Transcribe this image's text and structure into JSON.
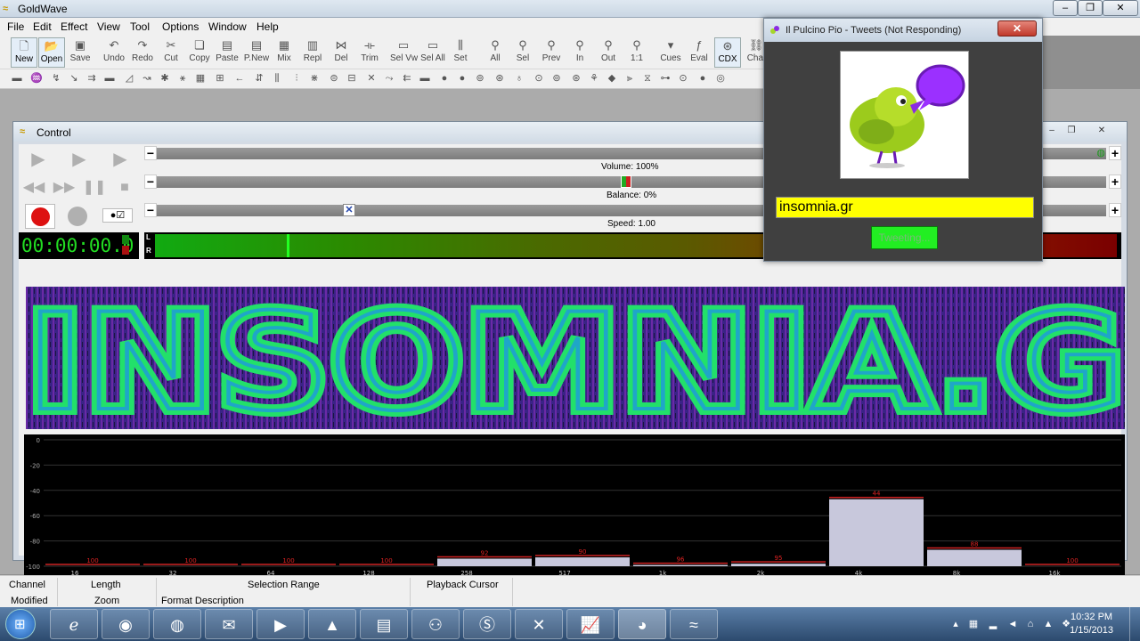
{
  "app": {
    "title": "GoldWave",
    "menu": [
      "File",
      "Edit",
      "Effect",
      "View",
      "Tool",
      "Options",
      "Window",
      "Help"
    ],
    "toolbar": [
      "New",
      "Open",
      "Save",
      "Undo",
      "Redo",
      "Cut",
      "Copy",
      "Paste",
      "P.New",
      "Mix",
      "Repl",
      "Del",
      "Trim",
      "Sel Vw",
      "Sel All",
      "Set",
      "All",
      "Sel",
      "Prev",
      "In",
      "Out",
      "1:1",
      "Cues",
      "Eval",
      "CDX",
      "Chai"
    ]
  },
  "control": {
    "title": "Control",
    "volume_label": "Volume: 100%",
    "balance_label": "Balance: 0%",
    "speed_label": "Speed: 1.00",
    "timecode": "00:00:00.0",
    "meter_channels": [
      "L",
      "R"
    ],
    "spectrogram_text": "INSOMNIA.G",
    "eq_y_ticks": [
      "0",
      "-20",
      "-40",
      "-60",
      "-80",
      "-100"
    ],
    "eq_bands": [
      "16",
      "32",
      "64",
      "128",
      "258",
      "517",
      "1k",
      "2k",
      "4k",
      "8k",
      "16k"
    ],
    "eq_levels": [
      -100,
      -100,
      -100,
      -100,
      -94,
      -93,
      -99,
      -98,
      -47,
      -87,
      -100
    ],
    "eq_peak_labels": [
      "100",
      "100",
      "100",
      "100",
      "92",
      "90",
      "96",
      "95",
      "44",
      "88",
      "100"
    ]
  },
  "tweet_window": {
    "title": "Il Pulcino Pio - Tweets (Not Responding)",
    "input_value": "insomnia.gr",
    "button_label": "Tweeting..."
  },
  "statusbar": {
    "channel": "Channel",
    "length": "Length",
    "selection_range": "Selection Range",
    "playback_cursor": "Playback Cursor",
    "modified": "Modified",
    "zoom": "Zoom",
    "format_description": "Format Description"
  },
  "taskbar": {
    "time": "10:32 PM",
    "date": "1/15/2013"
  }
}
